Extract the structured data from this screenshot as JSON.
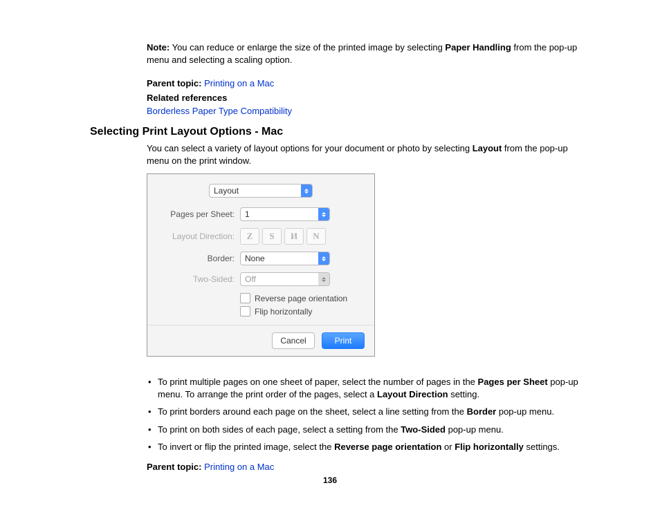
{
  "note": {
    "label": "Note:",
    "text_before": " You can reduce or enlarge the size of the printed image by selecting ",
    "bold_term": "Paper Handling",
    "text_after": " from the pop-up menu and selecting a scaling option."
  },
  "parent_topic": {
    "label": "Parent topic:",
    "link": "Printing on a Mac"
  },
  "related": {
    "label": "Related references",
    "link": "Borderless Paper Type Compatibility"
  },
  "section_title": "Selecting Print Layout Options - Mac",
  "intro": {
    "before": "You can select a variety of layout options for your document or photo by selecting ",
    "bold": "Layout",
    "after": " from the pop-up menu on the print window."
  },
  "dialog": {
    "menu": "Layout",
    "pages_label": "Pages per Sheet:",
    "pages_value": "1",
    "direction_label": "Layout Direction:",
    "dir_glyphs": [
      "Z",
      "S",
      "И",
      "N"
    ],
    "border_label": "Border:",
    "border_value": "None",
    "two_sided_label": "Two-Sided:",
    "two_sided_value": "Off",
    "reverse": "Reverse page orientation",
    "flip": "Flip horizontally",
    "cancel": "Cancel",
    "print": "Print"
  },
  "bullets": {
    "b1": {
      "t1": "To print multiple pages on one sheet of paper, select the number of pages in the ",
      "bold1": "Pages per Sheet",
      "t2": " pop-up menu. To arrange the print order of the pages, select a ",
      "bold2": "Layout Direction",
      "t3": " setting."
    },
    "b2": {
      "t1": "To print borders around each page on the sheet, select a line setting from the ",
      "bold1": "Border",
      "t2": " pop-up menu."
    },
    "b3": {
      "t1": "To print on both sides of each page, select a setting from the ",
      "bold1": "Two-Sided",
      "t2": " pop-up menu."
    },
    "b4": {
      "t1": "To invert or flip the printed image, select the ",
      "bold1": "Reverse page orientation",
      "t2": " or ",
      "bold2": "Flip horizontally",
      "t3": " settings."
    }
  },
  "parent_topic_2": {
    "label": "Parent topic:",
    "link": "Printing on a Mac"
  },
  "page_number": "136"
}
